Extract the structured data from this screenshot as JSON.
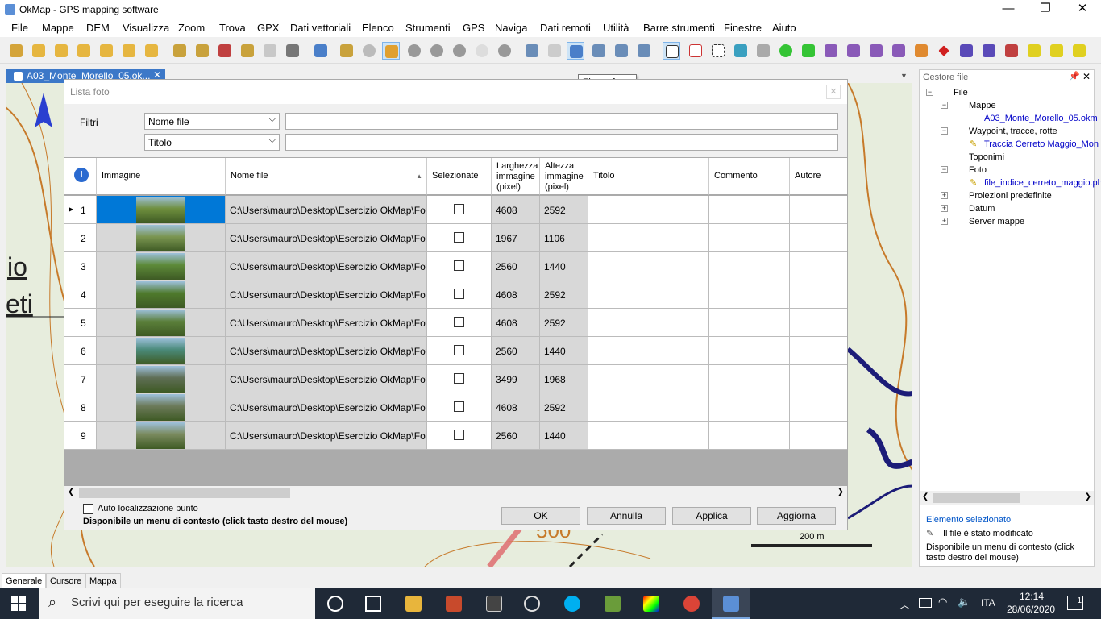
{
  "window": {
    "title": "OkMap - GPS mapping software"
  },
  "menu": [
    "File",
    "Mappe",
    "DEM",
    "Visualizza",
    "Zoom",
    "Trova",
    "GPX",
    "Dati vettoriali",
    "Elenco",
    "Strumenti",
    "GPS",
    "Naviga",
    "Dati remoti",
    "Utilità",
    "Barre strumenti",
    "Finestre",
    "Aiuto"
  ],
  "doc_tab": {
    "label": "A03_Monte_Morello_05.ok..."
  },
  "tooltip": "Elenco foto",
  "map": {
    "labels": [
      "io",
      "eti",
      "500"
    ],
    "scale": "200 m"
  },
  "dialog": {
    "title": "Lista foto",
    "filter_label": "Filtri",
    "filter1": {
      "selected": "Nome file",
      "value": ""
    },
    "filter2": {
      "selected": "Titolo",
      "value": ""
    },
    "columns": [
      "Immagine",
      "Nome file",
      "Selezionate",
      "Larghezza immagine (pixel)",
      "Altezza immagine (pixel)",
      "Titolo",
      "Commento",
      "Autore"
    ],
    "rows": [
      {
        "n": "1",
        "file": "C:\\Users\\mauro\\Desktop\\Esercizio OkMap\\Foto...",
        "w": "4608",
        "h": "2592"
      },
      {
        "n": "2",
        "file": "C:\\Users\\mauro\\Desktop\\Esercizio OkMap\\Foto...",
        "w": "1967",
        "h": "1106"
      },
      {
        "n": "3",
        "file": "C:\\Users\\mauro\\Desktop\\Esercizio OkMap\\Foto...",
        "w": "2560",
        "h": "1440"
      },
      {
        "n": "4",
        "file": "C:\\Users\\mauro\\Desktop\\Esercizio OkMap\\Foto...",
        "w": "4608",
        "h": "2592"
      },
      {
        "n": "5",
        "file": "C:\\Users\\mauro\\Desktop\\Esercizio OkMap\\Foto...",
        "w": "4608",
        "h": "2592"
      },
      {
        "n": "6",
        "file": "C:\\Users\\mauro\\Desktop\\Esercizio OkMap\\Foto...",
        "w": "2560",
        "h": "1440"
      },
      {
        "n": "7",
        "file": "C:\\Users\\mauro\\Desktop\\Esercizio OkMap\\Foto...",
        "w": "3499",
        "h": "1968"
      },
      {
        "n": "8",
        "file": "C:\\Users\\mauro\\Desktop\\Esercizio OkMap\\Foto...",
        "w": "4608",
        "h": "2592"
      },
      {
        "n": "9",
        "file": "C:\\Users\\mauro\\Desktop\\Esercizio OkMap\\Foto...",
        "w": "2560",
        "h": "1440"
      }
    ],
    "auto_loc": "Auto localizzazione punto",
    "context_note": "Disponibile un menu di contesto (click tasto destro del mouse)",
    "buttons": {
      "ok": "OK",
      "cancel": "Annulla",
      "apply": "Applica",
      "update": "Aggiorna"
    }
  },
  "file_manager": {
    "title": "Gestore file",
    "root": "File",
    "mappe": "Mappe",
    "map_file": "A03_Monte_Morello_05.okm",
    "wpt": "Waypoint, tracce, rotte",
    "track": "Traccia Cerreto Maggio_Mon",
    "topo": "Toponimi",
    "foto": "Foto",
    "foto_file": "file_indice_cerreto_maggio.ph",
    "proj": "Proiezioni predefinite",
    "datum": "Datum",
    "server": "Server mappe",
    "sel_title": "Elemento selezionato",
    "modified": "Il file è stato modificato",
    "note": "Disponibile un menu di contesto (click tasto destro del mouse)"
  },
  "bottom_tabs": [
    "Generale",
    "Cursore",
    "Mappa"
  ],
  "taskbar": {
    "search": "Scrivi qui per eseguire la ricerca",
    "lang": "ITA",
    "time": "12:14",
    "date": "28/06/2020",
    "notif": "1"
  }
}
